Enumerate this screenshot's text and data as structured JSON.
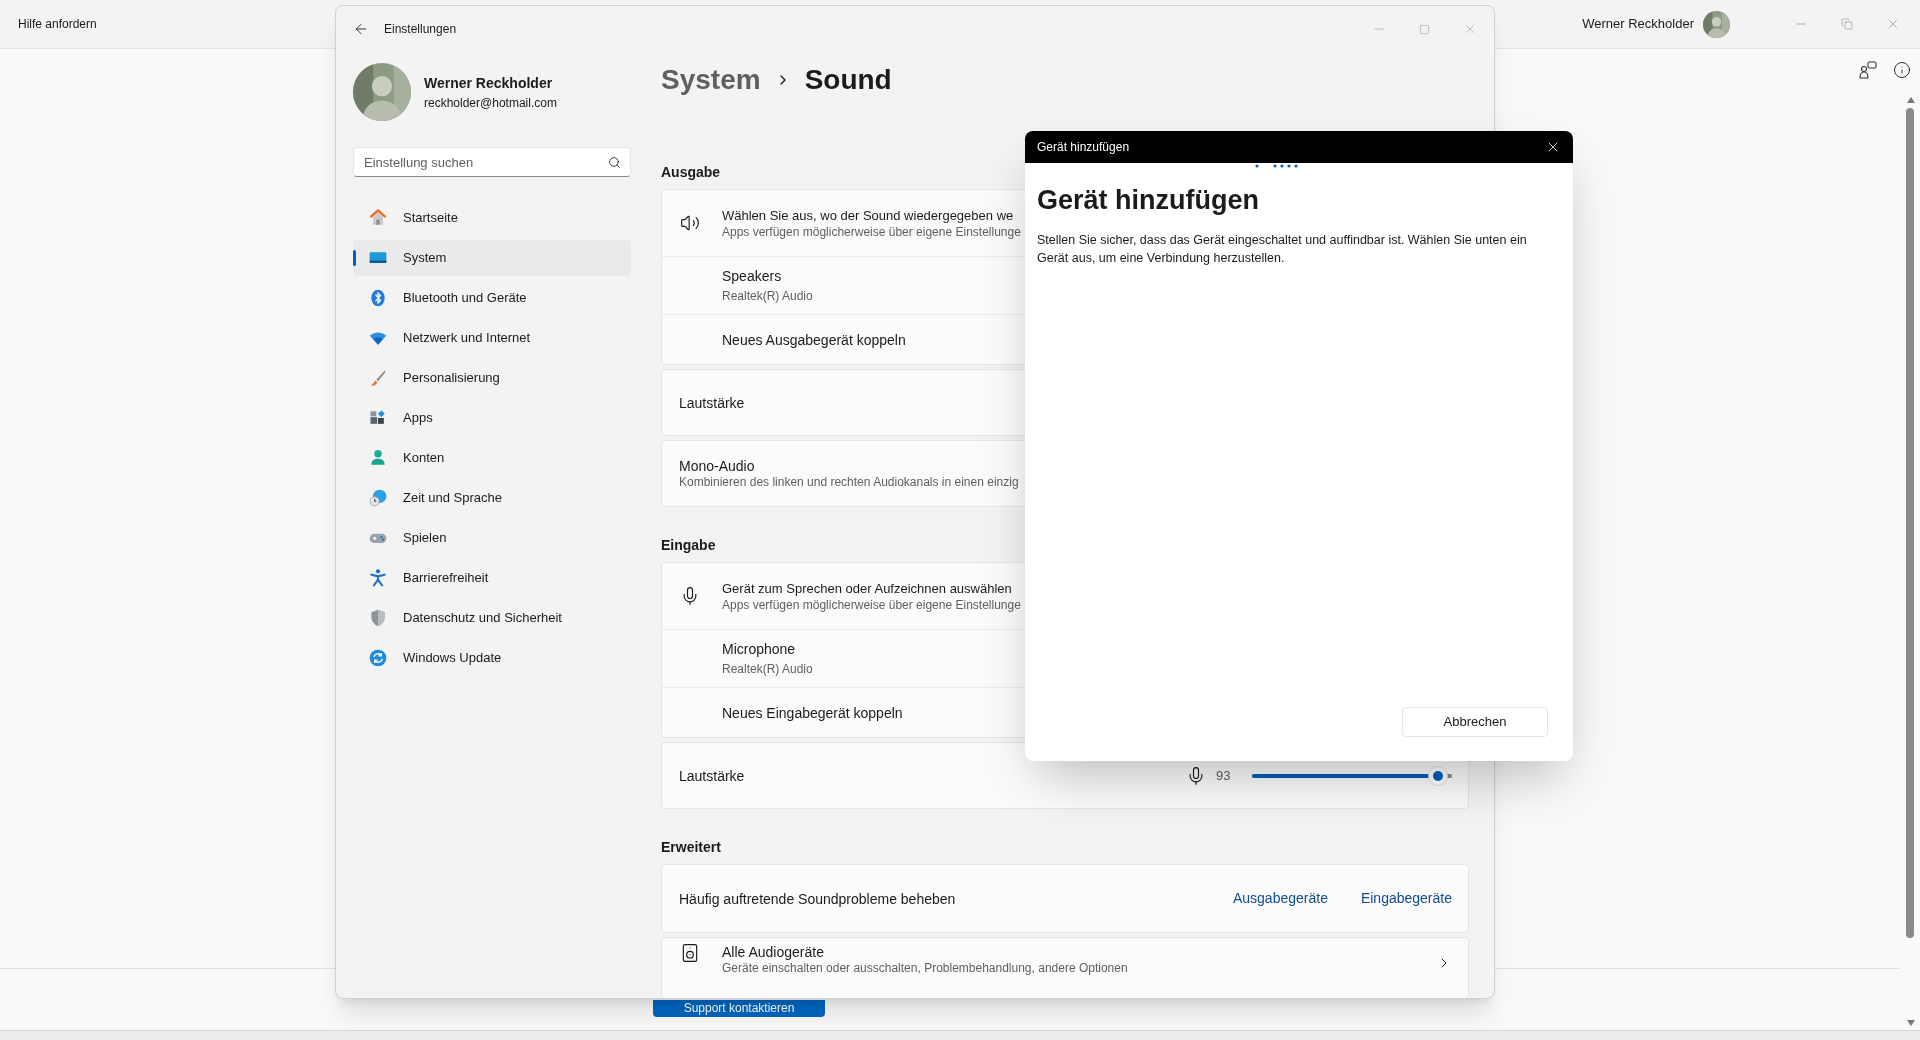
{
  "background_app": {
    "title": "Hilfe anfordern",
    "user_name": "Werner Reckholder",
    "support_button": "Support kontaktieren"
  },
  "settings_window": {
    "title": "Einstellungen",
    "profile": {
      "name": "Werner Reckholder",
      "email": "reckholder@hotmail.com"
    },
    "search": {
      "placeholder": "Einstellung suchen"
    },
    "nav": [
      {
        "label": "Startseite",
        "selected": false
      },
      {
        "label": "System",
        "selected": true
      },
      {
        "label": "Bluetooth und Geräte",
        "selected": false
      },
      {
        "label": "Netzwerk und Internet",
        "selected": false
      },
      {
        "label": "Personalisierung",
        "selected": false
      },
      {
        "label": "Apps",
        "selected": false
      },
      {
        "label": "Konten",
        "selected": false
      },
      {
        "label": "Zeit und Sprache",
        "selected": false
      },
      {
        "label": "Spielen",
        "selected": false
      },
      {
        "label": "Barrierefreiheit",
        "selected": false
      },
      {
        "label": "Datenschutz und Sicherheit",
        "selected": false
      },
      {
        "label": "Windows Update",
        "selected": false
      }
    ],
    "breadcrumb": {
      "parent": "System",
      "current": "Sound"
    },
    "sections": [
      {
        "title": "Ausgabe",
        "cards": [
          {
            "rows": [
              {
                "kind": "choice",
                "title": "Wählen Sie aus, wo der Sound wiedergegeben we",
                "subtitle": "Apps verfügen möglicherweise über eigene Einstellunge"
              },
              {
                "kind": "device",
                "title": "Speakers",
                "subtitle": "Realtek(R) Audio"
              },
              {
                "kind": "action",
                "title": "Neues Ausgabegerät koppeln"
              }
            ]
          },
          {
            "rows": [
              {
                "kind": "plain",
                "title": "Lautstärke"
              }
            ]
          },
          {
            "rows": [
              {
                "kind": "plain",
                "title": "Mono-Audio",
                "subtitle": "Kombinieren des linken und rechten Audiokanals in einen einzig"
              }
            ]
          }
        ]
      },
      {
        "title": "Eingabe",
        "cards": [
          {
            "rows": [
              {
                "kind": "choice",
                "title": "Gerät zum Sprechen oder Aufzeichnen auswählen",
                "subtitle": "Apps verfügen möglicherweise über eigene Einstellunge"
              },
              {
                "kind": "device",
                "title": "Microphone",
                "subtitle": "Realtek(R) Audio"
              },
              {
                "kind": "action",
                "title": "Neues Eingabegerät koppeln"
              }
            ]
          },
          {
            "rows": [
              {
                "kind": "volume",
                "title": "Lautstärke",
                "reading": "93",
                "level": 0.93
              }
            ]
          }
        ]
      },
      {
        "title": "Erweitert",
        "cards": [
          {
            "rows": [
              {
                "kind": "links",
                "title": "Häufig auftretende Soundprobleme beheben",
                "links": [
                  "Ausgabegeräte",
                  "Eingabegeräte"
                ]
              }
            ]
          },
          {
            "rows": [
              {
                "kind": "nav",
                "title": "Alle Audiogeräte",
                "subtitle": "Geräte einschalten oder ausschalten, Problembehandlung, andere Optionen"
              }
            ]
          }
        ]
      }
    ]
  },
  "dialog": {
    "title": "Gerät hinzufügen",
    "heading": "Gerät hinzufügen",
    "description": "Stellen Sie sicher, dass das Gerät eingeschaltet und auffindbar ist. Wählen Sie unten ein Gerät aus, um eine Verbindung herzustellen.",
    "cancel_button": "Abbrechen"
  }
}
